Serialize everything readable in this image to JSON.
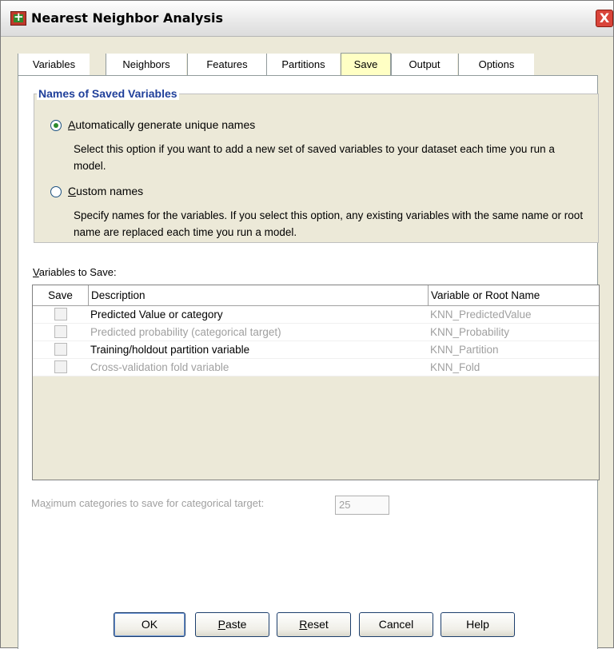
{
  "window": {
    "title": "Nearest Neighbor Analysis",
    "close_glyph": "X"
  },
  "tabs": [
    {
      "label": "Variables",
      "selected": false
    },
    {
      "label": "Neighbors",
      "selected": false
    },
    {
      "label": "Features",
      "selected": false
    },
    {
      "label": "Partitions",
      "selected": false
    },
    {
      "label": "Save",
      "selected": true
    },
    {
      "label": "Output",
      "selected": false
    },
    {
      "label": "Options",
      "selected": false
    }
  ],
  "names_group": {
    "title": "Names of Saved Variables",
    "auto_option": {
      "mnemonic": "A",
      "label_rest": "utomatically generate unique names",
      "selected": true,
      "description": "Select this option if you want to add a new set of saved variables to your dataset each time you run a model."
    },
    "custom_option": {
      "mnemonic": "C",
      "label_rest": "ustom names",
      "selected": false,
      "description": "Specify names for the variables. If you select this option, any existing variables with the same name or root name are replaced each time you run a model."
    }
  },
  "variables_section": {
    "label_mnemonic": "V",
    "label_rest": "ariables to Save:",
    "columns": {
      "save": "Save",
      "description": "Description",
      "name": "Variable or Root Name"
    },
    "rows": [
      {
        "description": "Predicted Value or category",
        "name": "KNN_PredictedValue",
        "enabled": true,
        "checked": false
      },
      {
        "description": "Predicted probability (categorical target)",
        "name": "KNN_Probability",
        "enabled": false,
        "checked": false
      },
      {
        "description": "Training/holdout partition variable",
        "name": "KNN_Partition",
        "enabled": true,
        "checked": false
      },
      {
        "description": "Cross-validation fold variable",
        "name": "KNN_Fold",
        "enabled": false,
        "checked": false
      }
    ]
  },
  "max_categories": {
    "label_pre": "Ma",
    "label_mnemonic": "x",
    "label_rest": "imum categories to save for categorical target:",
    "value": "25"
  },
  "buttons": {
    "ok": "OK",
    "paste_mnemonic": "P",
    "paste_rest": "aste",
    "reset_mnemonic": "R",
    "reset_rest": "eset",
    "cancel": "Cancel",
    "help": "Help"
  },
  "colors": {
    "selected_tab": "#ffffc4",
    "group_title": "#1f3f9a",
    "disabled_text": "#a0a0a0"
  }
}
